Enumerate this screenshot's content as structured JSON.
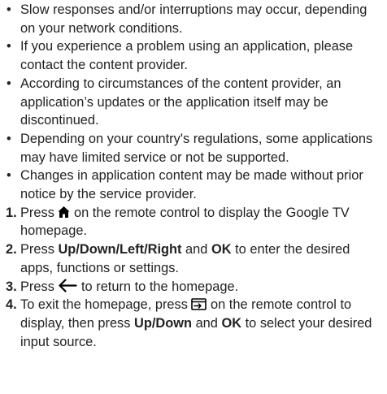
{
  "bullets": [
    "Slow responses and/or interruptions may occur, depending on your network conditions.",
    "If you experience a problem using an application, please contact the content provider.",
    "According to circumstances of the content provider, an application’s updates or the application itself may be discontinued.",
    "Depending on your country's regulations, some applications may have limited service or not be supported.",
    "Changes in application content may be made without prior notice by the service provider."
  ],
  "bullet_mark": "•",
  "steps": [
    {
      "number": "1.",
      "t1": "Press ",
      "icon": "home-icon",
      "t2": " on the remote control to display the Google TV homepage."
    },
    {
      "number": "2.",
      "t1": "Press ",
      "b1": "Up/Down/Left/Right",
      "t2": " and ",
      "b2": "OK",
      "t3": " to enter the desired apps, functions or settings."
    },
    {
      "number": "3.",
      "t1": "Press ",
      "icon": "back-arrow-icon",
      "t2": " to return to the homepage."
    },
    {
      "number": "4.",
      "t1": "To exit the homepage, press ",
      "icon": "input-source-icon",
      "t2": " on the remote control to display, then press ",
      "b1": "Up/Down",
      "t3": " and ",
      "b2": "OK",
      "t4": " to select your desired input source."
    }
  ]
}
